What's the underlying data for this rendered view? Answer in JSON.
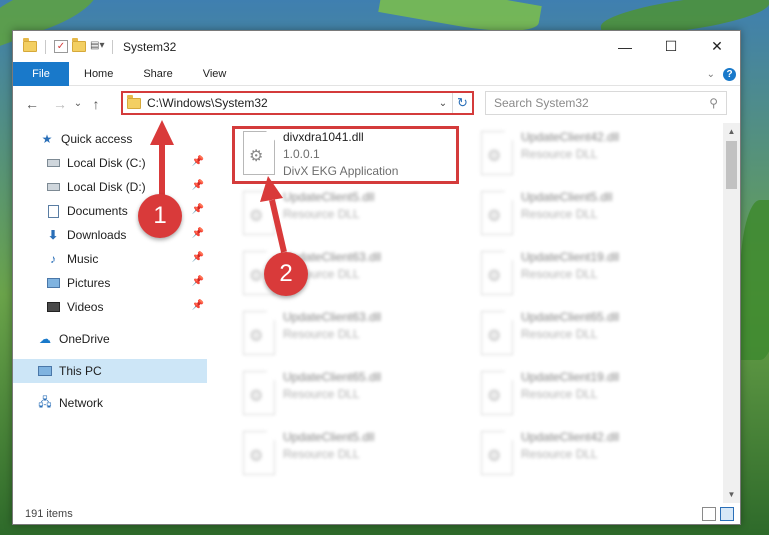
{
  "window": {
    "title": "System32",
    "controls": {
      "minimize": "—",
      "maximize": "☐",
      "close": "✕"
    }
  },
  "ribbon": {
    "tabs": [
      "File",
      "Home",
      "Share",
      "View"
    ]
  },
  "navigation": {
    "back": "←",
    "forward": "→",
    "recent": "⌄",
    "up": "↑",
    "address": "C:\\Windows\\System32",
    "search_placeholder": "Search System32"
  },
  "sidebar": {
    "items": [
      {
        "label": "Quick access",
        "icon": "star-icon"
      },
      {
        "label": "Local Disk (C:)",
        "icon": "drive-icon",
        "pinned": true
      },
      {
        "label": "Local Disk (D:)",
        "icon": "drive-icon",
        "pinned": true
      },
      {
        "label": "Documents",
        "icon": "documents-icon",
        "pinned": true
      },
      {
        "label": "Downloads",
        "icon": "download-icon",
        "pinned": true
      },
      {
        "label": "Music",
        "icon": "music-icon",
        "pinned": true
      },
      {
        "label": "Pictures",
        "icon": "pictures-icon",
        "pinned": true
      },
      {
        "label": "Videos",
        "icon": "videos-icon",
        "pinned": true
      },
      {
        "label": "OneDrive",
        "icon": "cloud-icon"
      },
      {
        "label": "This PC",
        "icon": "computer-icon",
        "selected": true
      },
      {
        "label": "Network",
        "icon": "network-icon"
      }
    ]
  },
  "files": {
    "left": [
      {
        "name": "divxdra1041.dll",
        "line2": "1.0.0.1",
        "line3": "DivX EKG Application"
      },
      {
        "name": "UpdateClient5.dll",
        "line2": "Resource DLL"
      },
      {
        "name": "UpdateClient63.dll",
        "line2": "Resource DLL"
      },
      {
        "name": "UpdateClient63.dll",
        "line2": "Resource DLL"
      },
      {
        "name": "UpdateClient65.dll",
        "line2": "Resource DLL"
      },
      {
        "name": "UpdateClient5.dll",
        "line2": "Resource DLL"
      }
    ],
    "right": [
      {
        "name": "UpdateClient42.dll",
        "line2": "Resource DLL"
      },
      {
        "name": "UpdateClient5.dll",
        "line2": "Resource DLL"
      },
      {
        "name": "UpdateClient19.dll",
        "line2": "Resource DLL"
      },
      {
        "name": "UpdateClient65.dll",
        "line2": "Resource DLL"
      },
      {
        "name": "UpdateClient19.dll",
        "line2": "Resource DLL"
      },
      {
        "name": "UpdateClient42.dll",
        "line2": "Resource DLL"
      }
    ]
  },
  "status": {
    "item_count": "191 items"
  },
  "callouts": [
    "1",
    "2"
  ],
  "colors": {
    "accent": "#1979ca",
    "highlight": "#d43b3b",
    "selected": "#cde6f7"
  }
}
